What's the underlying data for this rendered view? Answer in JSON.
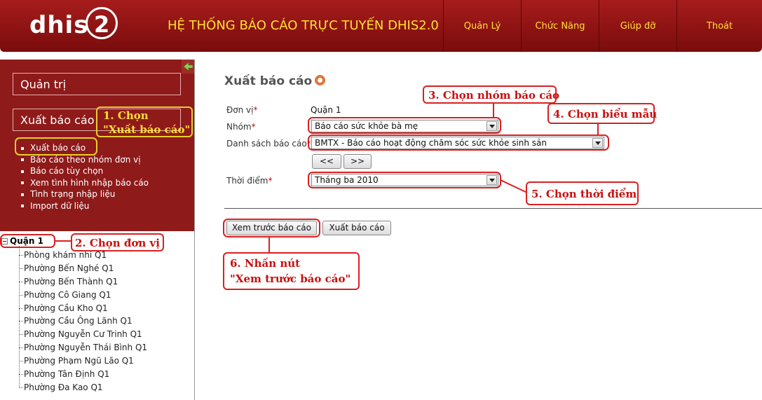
{
  "header": {
    "logo_text": "dhis",
    "logo_number": "2",
    "title": "HỆ THỐNG BÁO CÁO TRỰC TUYẾN DHIS2.0",
    "nav": [
      "Quản Lý",
      "Chức Năng",
      "Giúp đỡ",
      "Thoát"
    ]
  },
  "sidebar": {
    "box1": "Quản trị",
    "box2": "Xuất báo cáo",
    "menu": [
      "Xuất báo cáo",
      "Báo cáo theo nhóm đơn vị",
      "Báo cáo tùy chọn",
      "Xem tình hình nhập báo cáo",
      "Tình trạng nhập liệu",
      "Import dữ liệu"
    ]
  },
  "tree": {
    "root": "Quận 1",
    "children": [
      "Phòng khám nhi Q1",
      "Phường Bến Nghé Q1",
      "Phường Bến Thành Q1",
      "Phường Cô Giang Q1",
      "Phường Cầu Kho Q1",
      "Phường Cầu Ông Lãnh Q1",
      "Phường Nguyễn Cư Trinh Q1",
      "Phường Nguyễn Thái Bình Q1",
      "Phường Phạm Ngũ Lão Q1",
      "Phường Tân Định Q1",
      "Phường Đa Kao Q1"
    ]
  },
  "form": {
    "title": "Xuất báo cáo",
    "don_vi_label": "Đơn vị",
    "don_vi_value": "Quận 1",
    "nhom_label": "Nhóm",
    "nhom_value": "Báo cáo sức khỏe bà mẹ",
    "ds_label": "Danh sách báo cáo",
    "ds_value": "BMTX - Báo cáo hoạt động chăm sóc sức khỏe sinh sản",
    "prev_label": "<<",
    "next_label": ">>",
    "thoi_diem_label": "Thời điểm",
    "thoi_diem_value": "Tháng ba 2010",
    "preview_button": "Xem trước báo cáo",
    "export_button": "Xuất báo cáo",
    "required_mark": "*"
  },
  "annotations": {
    "a1_line1": "1. Chọn",
    "a1_line2": "\"Xuất báo cáo\"",
    "a2": "2. Chọn đơn vị",
    "a3": "3. Chọn nhóm báo cáo",
    "a4": "4. Chọn biểu mẫu",
    "a5": "5. Chọn thời điểm",
    "a6_line1": "6. Nhấn nút",
    "a6_line2": "\"Xem trước báo cáo\""
  },
  "colors": {
    "header_red": "#a61c1c",
    "sidebar_red": "#8e1a1a",
    "title_yellow": "#ffe033",
    "annotation_red": "#d92020"
  }
}
